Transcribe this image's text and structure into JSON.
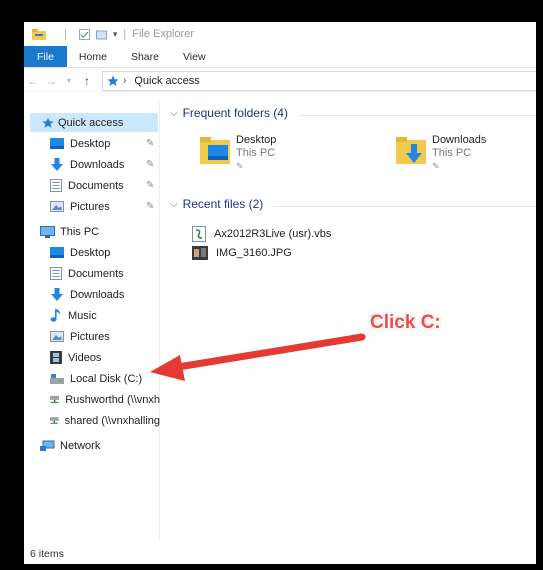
{
  "titlebar": {
    "title": "File Explorer"
  },
  "ribbon": {
    "tabs": [
      "File",
      "Home",
      "Share",
      "View"
    ]
  },
  "address": {
    "location": "Quick access"
  },
  "sidebar": {
    "quick_access": "Quick access",
    "qa_items": [
      "Desktop",
      "Downloads",
      "Documents",
      "Pictures"
    ],
    "this_pc": "This PC",
    "pc_items": [
      "Desktop",
      "Documents",
      "Downloads",
      "Music",
      "Pictures",
      "Videos",
      "Local Disk (C:)",
      "Rushworthd (\\\\vnxh",
      "shared (\\\\vnxhalling"
    ],
    "network": "Network"
  },
  "content": {
    "frequent_header": "Frequent folders (4)",
    "folders": [
      {
        "name": "Desktop",
        "location": "This PC"
      },
      {
        "name": "Downloads",
        "location": "This PC"
      }
    ],
    "recent_header": "Recent files (2)",
    "files": [
      "Ax2012R3Live (usr).vbs",
      "IMG_3160.JPG"
    ]
  },
  "status": {
    "text": "6 items"
  },
  "annotation": {
    "text": "Click C:",
    "color": "#ef4b4b"
  },
  "colors": {
    "file_tab": "#1979ca",
    "selected": "#cce8ff",
    "header": "#1e3287"
  }
}
